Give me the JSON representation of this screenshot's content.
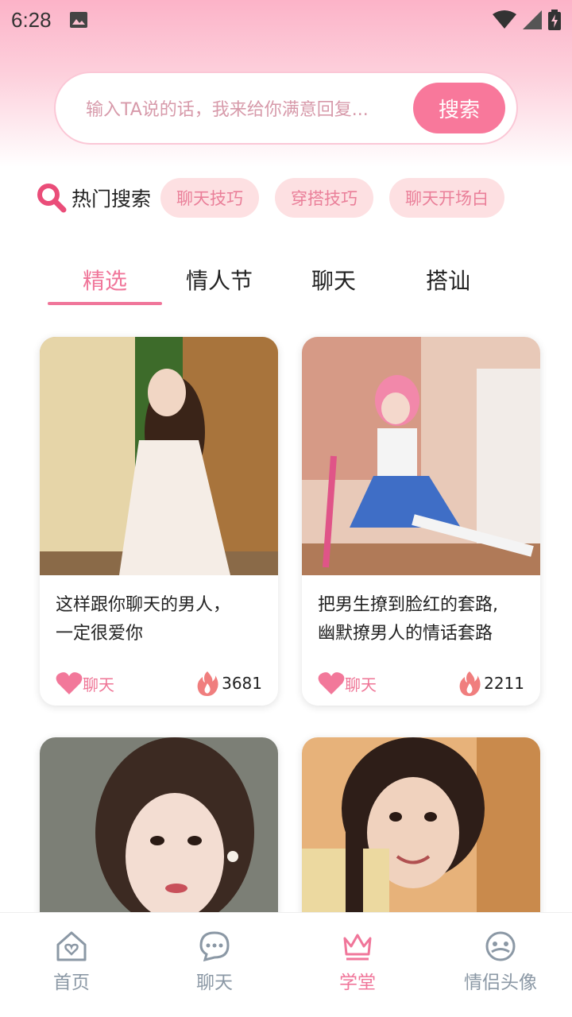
{
  "status_bar": {
    "time": "6:28"
  },
  "search": {
    "placeholder": "输入TA说的话，我来给你满意回复...",
    "button_label": "搜索"
  },
  "hot_search": {
    "label": "热门搜索",
    "tags": [
      "聊天技巧",
      "穿搭技巧",
      "聊天开场白"
    ]
  },
  "tabs": [
    {
      "label": "精选",
      "active": true
    },
    {
      "label": "情人节",
      "active": false
    },
    {
      "label": "聊天",
      "active": false
    },
    {
      "label": "搭讪",
      "active": false
    }
  ],
  "cards": [
    {
      "title_line1": "这样跟你聊天的男人，",
      "title_line2": "一定很爱你",
      "chat_label": "聊天",
      "count": "3681",
      "image": "woman-sitting-white-dress"
    },
    {
      "title_line1": "把男生撩到脸红的套路,",
      "title_line2": "幽默撩男人的情话套路",
      "chat_label": "聊天",
      "count": "2211",
      "image": "cosplay-girl-pink-hair"
    },
    {
      "image": "woman-portrait-earring"
    },
    {
      "image": "girl-braids-smiling"
    }
  ],
  "bottom_nav": [
    {
      "label": "首页",
      "icon": "home-heart-icon",
      "active": false
    },
    {
      "label": "聊天",
      "icon": "chat-bubble-icon",
      "active": false
    },
    {
      "label": "学堂",
      "icon": "crown-icon",
      "active": true
    },
    {
      "label": "情侣头像",
      "icon": "face-icon",
      "active": false
    }
  ],
  "colors": {
    "accent": "#f0769a",
    "tag_bg": "#fde0e2",
    "nav_inactive": "#8b98a5"
  }
}
